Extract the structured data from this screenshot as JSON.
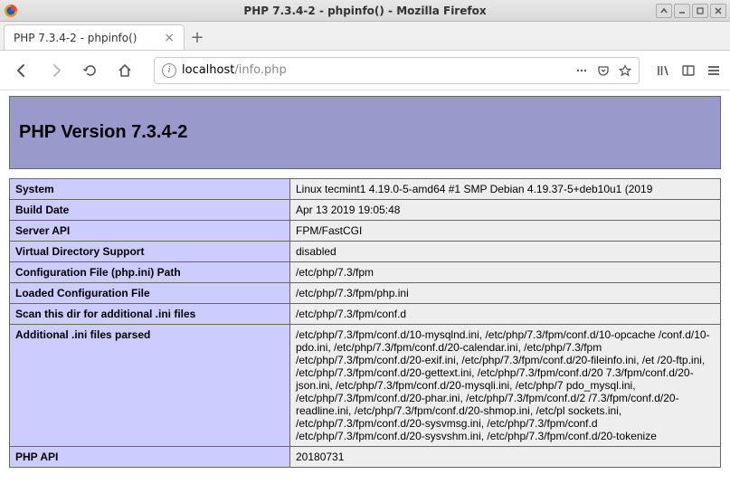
{
  "window": {
    "title": "PHP 7.3.4-2 - phpinfo() - Mozilla Firefox"
  },
  "tab": {
    "label": "PHP 7.3.4-2 - phpinfo()"
  },
  "url": {
    "host": "localhost",
    "path": "/info.php"
  },
  "page": {
    "header": "PHP Version 7.3.4-2",
    "rows": [
      {
        "key": "System",
        "value": "Linux tecmint1 4.19.0-5-amd64 #1 SMP Debian 4.19.37-5+deb10u1 (2019"
      },
      {
        "key": "Build Date",
        "value": "Apr 13 2019 19:05:48"
      },
      {
        "key": "Server API",
        "value": "FPM/FastCGI"
      },
      {
        "key": "Virtual Directory Support",
        "value": "disabled"
      },
      {
        "key": "Configuration File (php.ini) Path",
        "value": "/etc/php/7.3/fpm"
      },
      {
        "key": "Loaded Configuration File",
        "value": "/etc/php/7.3/fpm/php.ini"
      },
      {
        "key": "Scan this dir for additional .ini files",
        "value": "/etc/php/7.3/fpm/conf.d"
      },
      {
        "key": "Additional .ini files parsed",
        "value": "/etc/php/7.3/fpm/conf.d/10-mysqlnd.ini, /etc/php/7.3/fpm/conf.d/10-opcache /conf.d/10-pdo.ini, /etc/php/7.3/fpm/conf.d/20-calendar.ini, /etc/php/7.3/fpm /etc/php/7.3/fpm/conf.d/20-exif.ini, /etc/php/7.3/fpm/conf.d/20-fileinfo.ini, /et /20-ftp.ini, /etc/php/7.3/fpm/conf.d/20-gettext.ini, /etc/php/7.3/fpm/conf.d/20 7.3/fpm/conf.d/20-json.ini, /etc/php/7.3/fpm/conf.d/20-mysqli.ini, /etc/php/7 pdo_mysql.ini, /etc/php/7.3/fpm/conf.d/20-phar.ini, /etc/php/7.3/fpm/conf.d/2 /7.3/fpm/conf.d/20-readline.ini, /etc/php/7.3/fpm/conf.d/20-shmop.ini, /etc/pl sockets.ini, /etc/php/7.3/fpm/conf.d/20-sysvmsg.ini, /etc/php/7.3/fpm/conf.d /etc/php/7.3/fpm/conf.d/20-sysvshm.ini, /etc/php/7.3/fpm/conf.d/20-tokenize"
      },
      {
        "key": "PHP API",
        "value": "20180731"
      }
    ]
  }
}
